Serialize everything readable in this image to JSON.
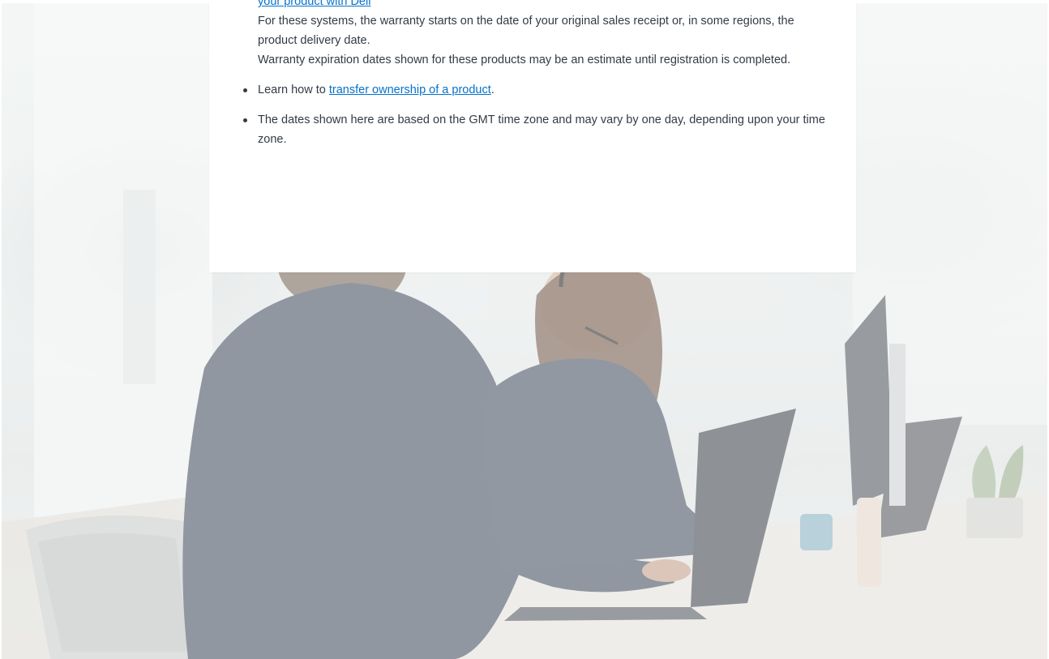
{
  "warranty_info": {
    "link_register": "your product with Dell",
    "para_start": "For these systems, the warranty starts on the date of your original sales receipt or, in some regions, the product delivery date.",
    "para_estimate": "Warranty expiration dates shown for these products may be an estimate until registration is completed.",
    "transfer_prefix": "Learn how to ",
    "transfer_link": "transfer ownership of a product",
    "transfer_suffix": ".",
    "timezone_note": "The dates shown here are based on the GMT time zone and may vary by one day, depending upon your time zone."
  },
  "colors": {
    "link": "#0672cb",
    "text": "#333b45",
    "card": "#ffffff"
  }
}
